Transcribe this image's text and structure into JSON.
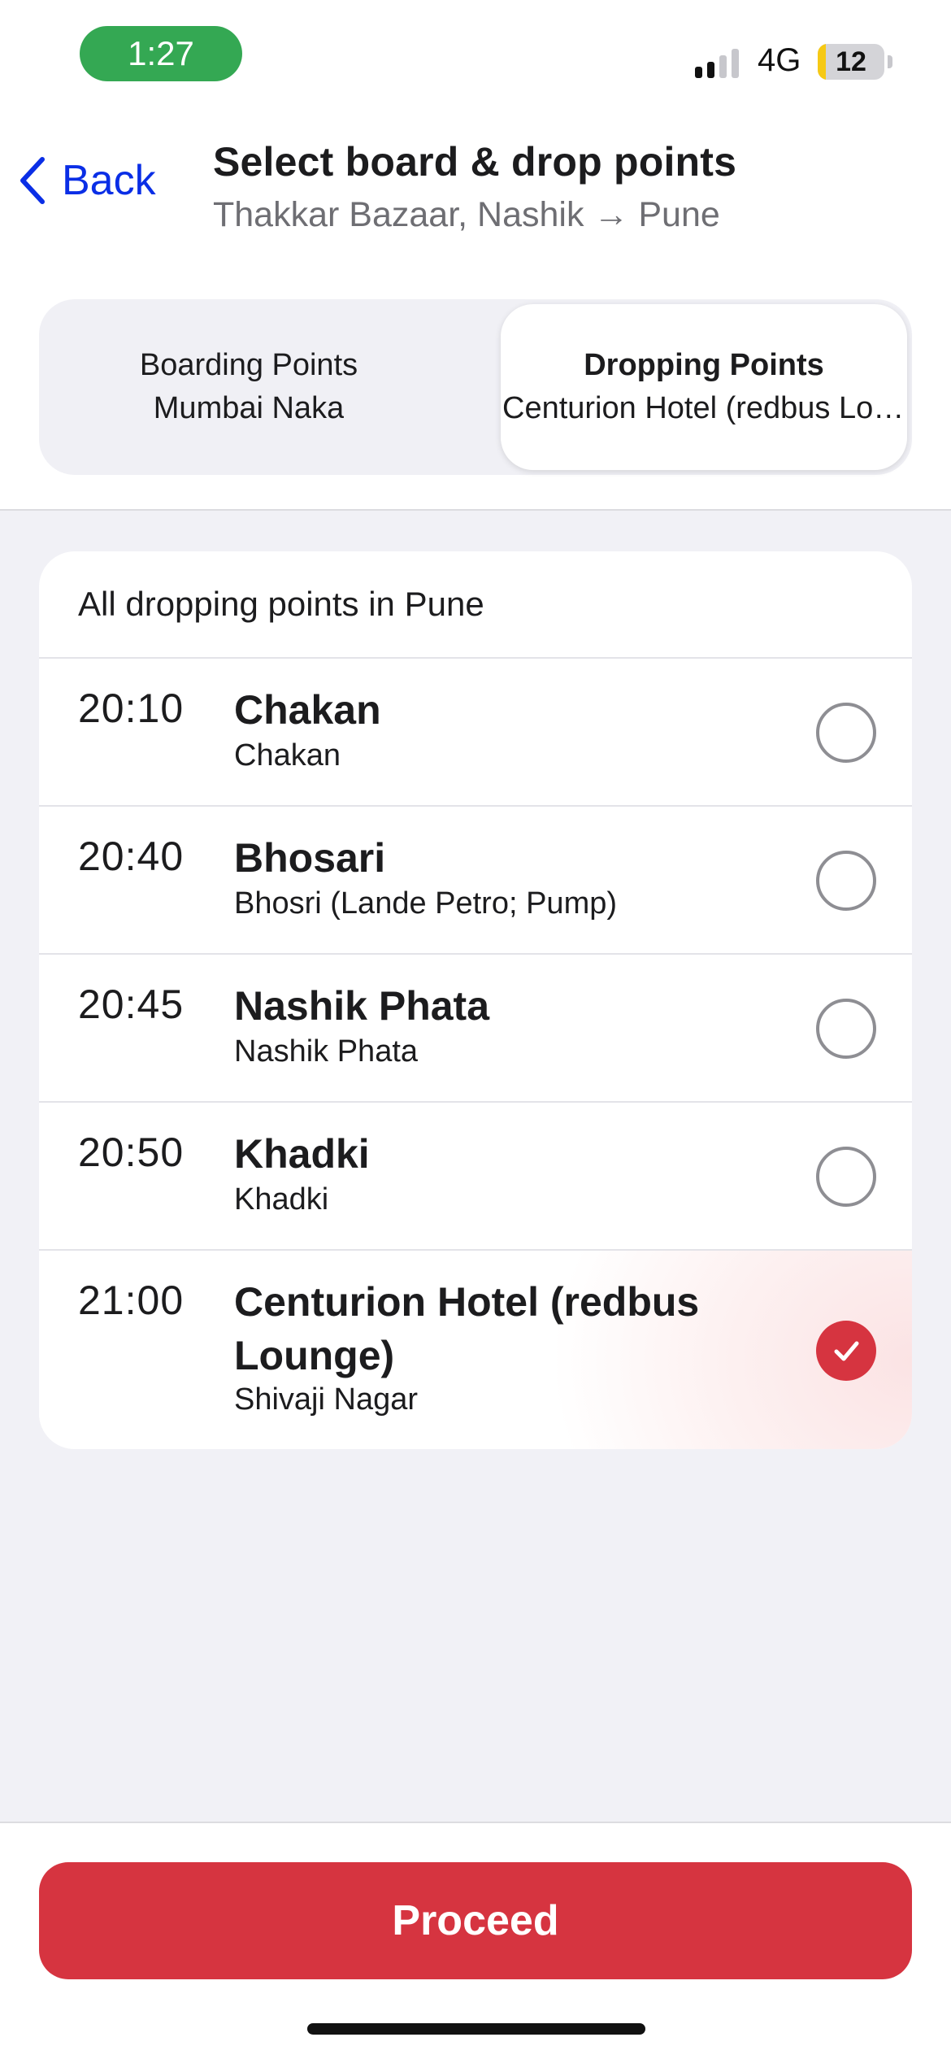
{
  "status_bar": {
    "time": "1:27",
    "network": "4G",
    "battery_level": "12",
    "signal_bars_active": 2,
    "signal_bars_total": 4
  },
  "header": {
    "back_label": "Back",
    "title": "Select board & drop points",
    "subtitle": "Thakkar Bazaar, Nashik → Pune"
  },
  "tabs": [
    {
      "title": "Boarding Points",
      "value": "Mumbai Naka",
      "selected": false
    },
    {
      "title": "Dropping Points",
      "value": "Centurion Hotel (redbus Lounge)",
      "selected": true
    }
  ],
  "list": {
    "header": "All dropping points in Pune",
    "items": [
      {
        "time": "20:10",
        "name": "Chakan",
        "location": "Chakan",
        "selected": false
      },
      {
        "time": "20:40",
        "name": "Bhosari",
        "location": "Bhosri (Lande Petro; Pump)",
        "selected": false
      },
      {
        "time": "20:45",
        "name": "Nashik Phata",
        "location": "Nashik Phata",
        "selected": false
      },
      {
        "time": "20:50",
        "name": "Khadki",
        "location": "Khadki",
        "selected": false
      },
      {
        "time": "21:00",
        "name": "Centurion Hotel (redbus Lounge)",
        "location": "Shivaji Nagar",
        "selected": true
      }
    ]
  },
  "footer": {
    "proceed_label": "Proceed"
  },
  "colors": {
    "accent": "#d63440",
    "link": "#0a2ee6",
    "time_pill": "#34a853",
    "background_gray": "#f1f1f6"
  }
}
